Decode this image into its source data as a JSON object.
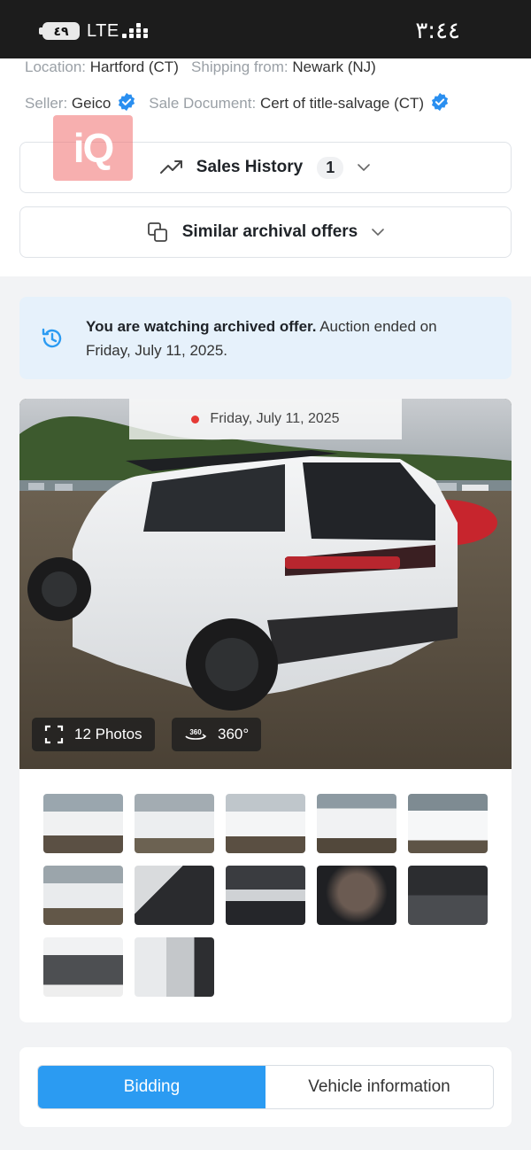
{
  "status_bar": {
    "battery": "٤٩",
    "network": "LTE",
    "time": "٣:٤٤"
  },
  "lot_info": {
    "location_label": "Location:",
    "location_value": "Hartford (CT)",
    "shipping_label": "Shipping from:",
    "shipping_value": "Newark (NJ)",
    "seller_label": "Seller:",
    "seller_value": "Geico",
    "sale_doc_label": "Sale Document:",
    "sale_doc_value": "Cert of title-salvage (CT)",
    "watermark": "iQ"
  },
  "sales_history": {
    "label": "Sales History",
    "count": "1"
  },
  "similar_offers": {
    "label": "Similar archival offers"
  },
  "notice": {
    "bold": "You are watching archived offer.",
    "text": " Auction ended on Friday, July 11, 2025."
  },
  "gallery": {
    "date": "Friday, July 11, 2025",
    "photos_label": "12 Photos",
    "view360_label": "360°",
    "thumbnails": [
      {
        "name": "front-left"
      },
      {
        "name": "rear-left"
      },
      {
        "name": "front-right"
      },
      {
        "name": "front-right-close"
      },
      {
        "name": "front"
      },
      {
        "name": "rear"
      },
      {
        "name": "interior-airbag"
      },
      {
        "name": "dashboard"
      },
      {
        "name": "infotainment"
      },
      {
        "name": "rear-seats"
      },
      {
        "name": "engine"
      },
      {
        "name": "door-label"
      }
    ]
  },
  "tabs": {
    "active": "Bidding",
    "inactive": "Vehicle information"
  },
  "colors": {
    "accent": "#2b9bf2",
    "notice_bg": "#e6f1fb",
    "verified": "#2a8ff0",
    "watermark": "#f16e6e"
  }
}
